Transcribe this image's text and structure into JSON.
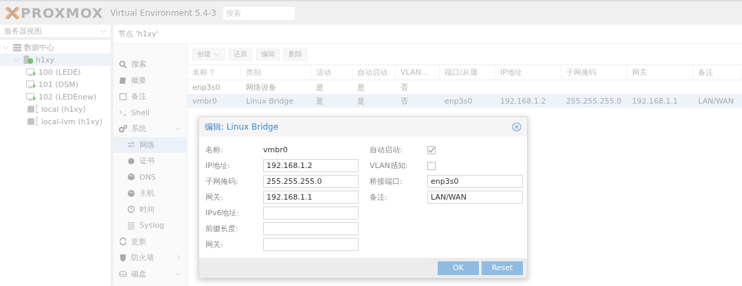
{
  "header": {
    "logo": "PROXMOX",
    "version": "Virtual Environment 5.4-3",
    "search": {
      "placeholder": "搜索"
    }
  },
  "tree": {
    "view_selector": {
      "value": "服务器视图"
    },
    "items": [
      {
        "label": "数据中心",
        "kind": "datacenter",
        "expanded": true,
        "selected": false,
        "children": [
          {
            "label": "h1xy",
            "kind": "node",
            "expanded": true,
            "selected": true,
            "children": [
              {
                "label": "100 (LEDE)",
                "kind": "vm",
                "selected": false
              },
              {
                "label": "101 (DSM)",
                "kind": "vm",
                "selected": false
              },
              {
                "label": "102 (LEDEnew)",
                "kind": "vm",
                "selected": false
              },
              {
                "label": "local (h1xy)",
                "kind": "storage",
                "selected": false
              },
              {
                "label": "local-lvm (h1xy)",
                "kind": "storage",
                "selected": false
              }
            ]
          }
        ]
      }
    ]
  },
  "node_title": "节点 'h1xy'",
  "menu": [
    {
      "label": "搜索",
      "kind": "search",
      "selected": false
    },
    {
      "label": "概要",
      "kind": "book",
      "selected": false
    },
    {
      "label": "备注",
      "kind": "note",
      "selected": false
    },
    {
      "label": "Shell",
      "kind": "shell",
      "selected": false
    },
    {
      "label": "系统",
      "kind": "gears",
      "selected": false,
      "expanded": true,
      "children": [
        {
          "label": "网络",
          "kind": "exchange",
          "selected": true
        },
        {
          "label": "证书",
          "kind": "cert",
          "selected": false
        },
        {
          "label": "DNS",
          "kind": "globe",
          "selected": false
        },
        {
          "label": "主机",
          "kind": "globe",
          "selected": false
        },
        {
          "label": "时间",
          "kind": "clock",
          "selected": false
        },
        {
          "label": "Syslog",
          "kind": "list",
          "selected": false
        }
      ]
    },
    {
      "label": "更新",
      "kind": "refresh",
      "selected": false
    },
    {
      "label": "防火墙",
      "kind": "shield",
      "selected": false,
      "expanded": false
    },
    {
      "label": "磁盘",
      "kind": "disk",
      "selected": false,
      "expanded": true
    }
  ],
  "toolbar": [
    {
      "label": "创建",
      "kind": "menu"
    },
    {
      "label": "还原",
      "kind": "plain"
    },
    {
      "label": "编辑",
      "kind": "plain"
    },
    {
      "label": "删除",
      "kind": "plain"
    }
  ],
  "table": {
    "columns": [
      {
        "label": "名称",
        "sorted": true
      },
      {
        "label": "类别"
      },
      {
        "label": "活动"
      },
      {
        "label": "自动启动"
      },
      {
        "label": "VLAN..."
      },
      {
        "label": "端口/从属"
      },
      {
        "label": "IP地址"
      },
      {
        "label": "子网掩码"
      },
      {
        "label": "网关"
      },
      {
        "label": "备注"
      }
    ],
    "rows": [
      {
        "selected": false,
        "cells": [
          "enp3s0",
          "网络设备",
          "是",
          "是",
          "否",
          null,
          null,
          null,
          null,
          null
        ]
      },
      {
        "selected": true,
        "cells": [
          "vmbr0",
          "Linux Bridge",
          "是",
          "是",
          "否",
          "enp3s0",
          "192.168.1.2",
          "255.255.255.0",
          "192.168.1.1",
          "LAN/WAN"
        ]
      }
    ]
  },
  "dialog": {
    "title": "编辑: Linux Bridge",
    "left": [
      {
        "label": "名称:",
        "kind": "text",
        "value": "vmbr0"
      },
      {
        "label": "IP地址:",
        "kind": "input",
        "value": "192.168.1.2"
      },
      {
        "label": "子网掩码:",
        "kind": "input",
        "value": "255.255.255.0"
      },
      {
        "label": "网关:",
        "kind": "input",
        "value": "192.168.1.1"
      },
      {
        "label": "IPv6地址:",
        "kind": "input"
      },
      {
        "label": "前缀长度:",
        "kind": "input"
      },
      {
        "label": "网关:",
        "kind": "input"
      }
    ],
    "right": [
      {
        "label": "自动启动:",
        "kind": "checkbox",
        "checked": true
      },
      {
        "label": "VLAN感知:",
        "kind": "checkbox",
        "checked": false
      },
      {
        "label": "桥接端口:",
        "kind": "input",
        "value": "enp3s0"
      },
      {
        "label": "备注:",
        "kind": "input",
        "value": "LAN/WAN"
      }
    ],
    "buttons": [
      "OK",
      "Reset"
    ]
  }
}
